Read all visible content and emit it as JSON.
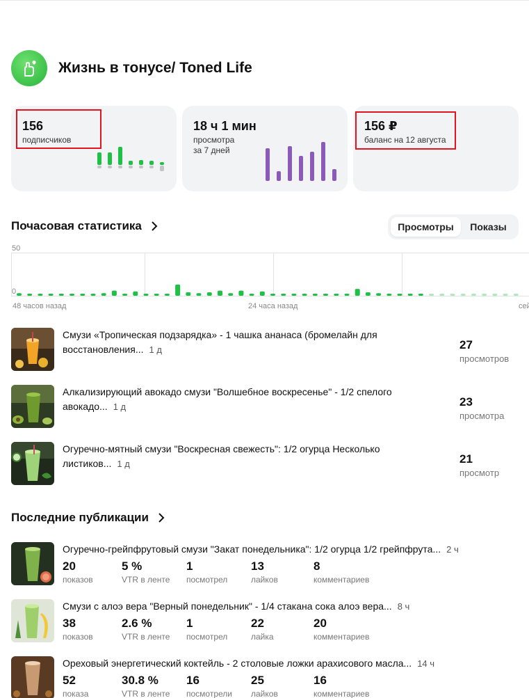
{
  "channel": {
    "title": "Жизнь в тонусе/ Toned Life"
  },
  "cards": {
    "subscribers": {
      "value": "156",
      "label": "подписчиков",
      "bars": [
        0.45,
        0.45,
        0.65,
        0.15,
        0.18,
        0.15,
        0.1
      ]
    },
    "views": {
      "value": "18 ч 1 мин",
      "label1": "просмотра",
      "label2": "за 7 дней",
      "bars": [
        0.95,
        0.28,
        1.0,
        0.72,
        0.84,
        1.13,
        0.35
      ]
    },
    "balance": {
      "value": "156 ₽",
      "label": "баланс на 12 августа"
    }
  },
  "hourly": {
    "title": "Почасовая статистика",
    "toggle": {
      "active": "Просмотры",
      "inactive": "Показы"
    },
    "y_top": "50",
    "y_bottom": "0",
    "x_labels": [
      "48 часов назад",
      "24 часа назад",
      "сейчас"
    ],
    "accent": "#1ec045"
  },
  "chart_data": {
    "type": "bar",
    "ylim": [
      0,
      50
    ],
    "x_labels": [
      "48 часов назад",
      "24 часа назад",
      "сейчас"
    ],
    "values": [
      3,
      2,
      2,
      2,
      2,
      2,
      2,
      2,
      3,
      6,
      2,
      5,
      2,
      2,
      2,
      13,
      4,
      3,
      4,
      6,
      3,
      6,
      2,
      5,
      2,
      2,
      2,
      2,
      2,
      2,
      2,
      2,
      8,
      4,
      3,
      2,
      2,
      2,
      2,
      2,
      2,
      2,
      2,
      2,
      2,
      2,
      2,
      2
    ]
  },
  "top_posts": [
    {
      "text": "Смузи «Тропическая подзарядка» - 1 чашка ананаса (бромелайн для восстановления...",
      "age": "1 д",
      "count": "27",
      "unit": "просмотров"
    },
    {
      "text": "Алкализирующий авокадо смузи \"Волшебное воскресенье\" - 1/2 спелого авокадо...",
      "age": "1 д",
      "count": "23",
      "unit": "просмотра"
    },
    {
      "text": "Огуречно-мятный смузи \"Воскресная свежесть\": 1/2 огурца Несколько листиков...",
      "age": "1 д",
      "count": "21",
      "unit": "просмотр"
    }
  ],
  "recent": {
    "title": "Последние публикации",
    "items": [
      {
        "title": "Огуречно-грейпфрутовый смузи \"Закат понедельника\": 1/2 огурца 1/2 грейпфрута...",
        "age": "2 ч",
        "stats": [
          {
            "n": "20",
            "l": "показов"
          },
          {
            "n": "5 %",
            "l": "VTR в ленте"
          },
          {
            "n": "1",
            "l": "посмотрел"
          },
          {
            "n": "13",
            "l": "лайков"
          },
          {
            "n": "8",
            "l": "комментариев"
          }
        ]
      },
      {
        "title": "Смузи с алоэ вера \"Верный понедельник\" - 1/4 стакана сока алоэ вера...",
        "age": "8 ч",
        "stats": [
          {
            "n": "38",
            "l": "показов"
          },
          {
            "n": "2.6 %",
            "l": "VTR в ленте"
          },
          {
            "n": "1",
            "l": "посмотрел"
          },
          {
            "n": "22",
            "l": "лайка"
          },
          {
            "n": "20",
            "l": "комментариев"
          }
        ]
      },
      {
        "title": "Ореховый энергетический коктейль - 2 столовые ложки арахисового масла...",
        "age": "14 ч",
        "stats": [
          {
            "n": "52",
            "l": "показа"
          },
          {
            "n": "30.8 %",
            "l": "VTR в ленте"
          },
          {
            "n": "16",
            "l": "посмотрели"
          },
          {
            "n": "25",
            "l": "лайков"
          },
          {
            "n": "16",
            "l": "комментариев"
          }
        ]
      }
    ]
  }
}
